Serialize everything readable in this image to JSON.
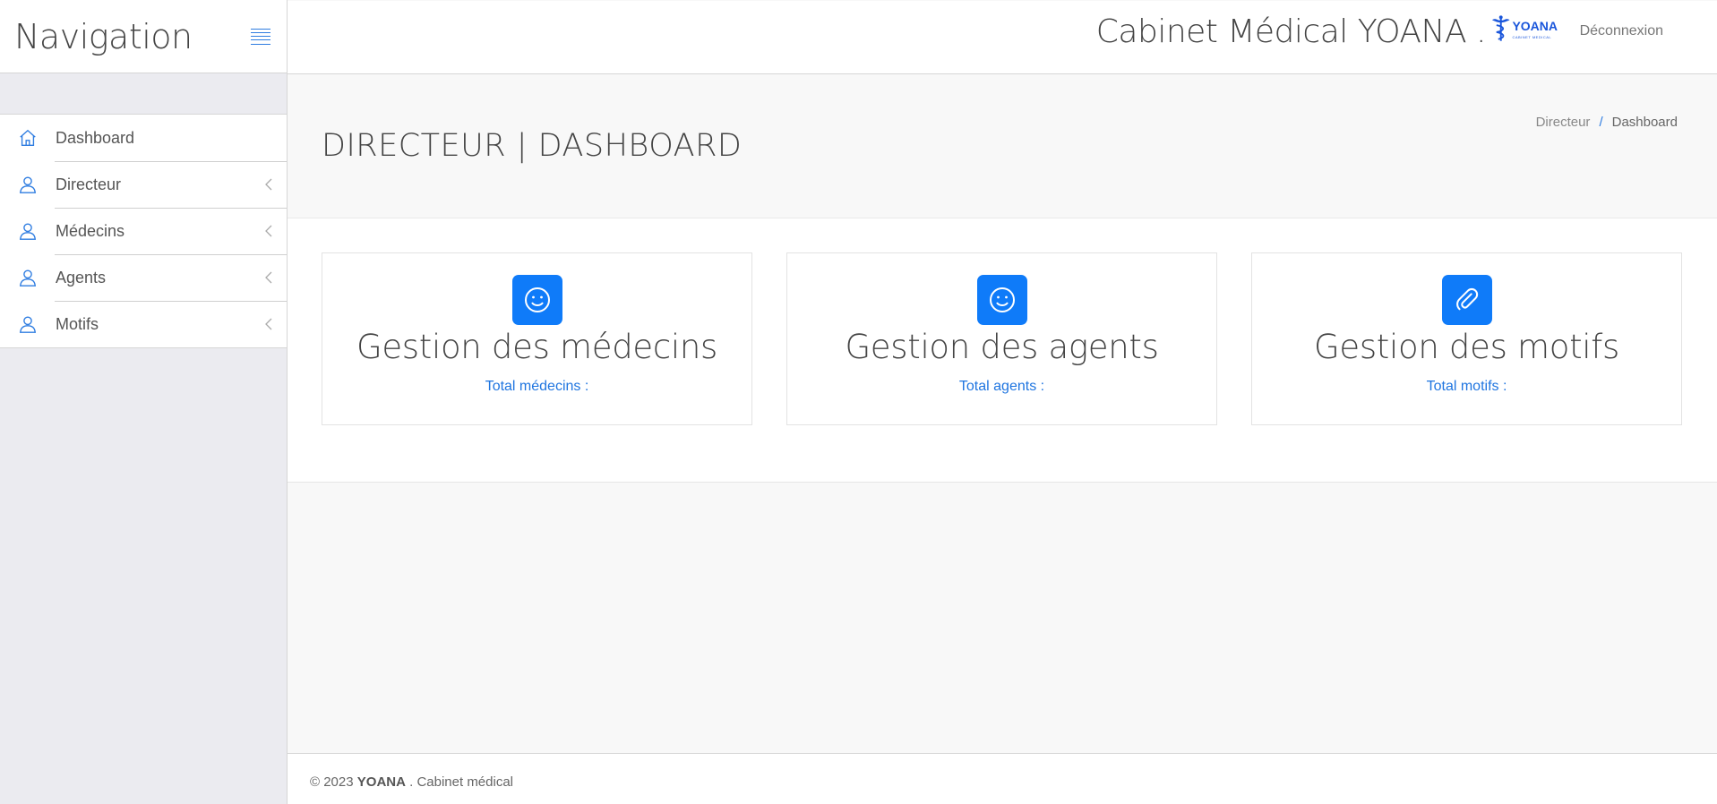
{
  "sidebar": {
    "title": "Navigation",
    "items": [
      {
        "label": "Dashboard",
        "icon": "home-icon",
        "has_submenu": false
      },
      {
        "label": "Directeur",
        "icon": "user-icon",
        "has_submenu": true
      },
      {
        "label": "Médecins",
        "icon": "user-icon",
        "has_submenu": true
      },
      {
        "label": "Agents",
        "icon": "user-icon",
        "has_submenu": true
      },
      {
        "label": "Motifs",
        "icon": "user-icon",
        "has_submenu": true
      }
    ]
  },
  "header": {
    "app_title": "Cabinet Médical YOANA .",
    "logo_text": "YOANA",
    "logo_subtext": "CABINET MEDICAL",
    "logout_label": "Déconnexion"
  },
  "page": {
    "title": "DIRECTEUR | DASHBOARD",
    "breadcrumb": [
      "Directeur",
      "Dashboard"
    ],
    "breadcrumb_separator": "/"
  },
  "cards": [
    {
      "title": "Gestion des médecins",
      "subtitle": "Total médecins :",
      "icon": "smile-icon"
    },
    {
      "title": "Gestion des agents",
      "subtitle": "Total agents :",
      "icon": "smile-icon"
    },
    {
      "title": "Gestion des motifs",
      "subtitle": "Total motifs :",
      "icon": "paperclip-icon"
    }
  ],
  "footer": {
    "prefix": "© 2023",
    "brand": "YOANA",
    "suffix": ". Cabinet médical"
  },
  "colors": {
    "accent": "#0f7bf9",
    "link": "#1f75e0",
    "sidebar_bg": "#ebebf0"
  }
}
